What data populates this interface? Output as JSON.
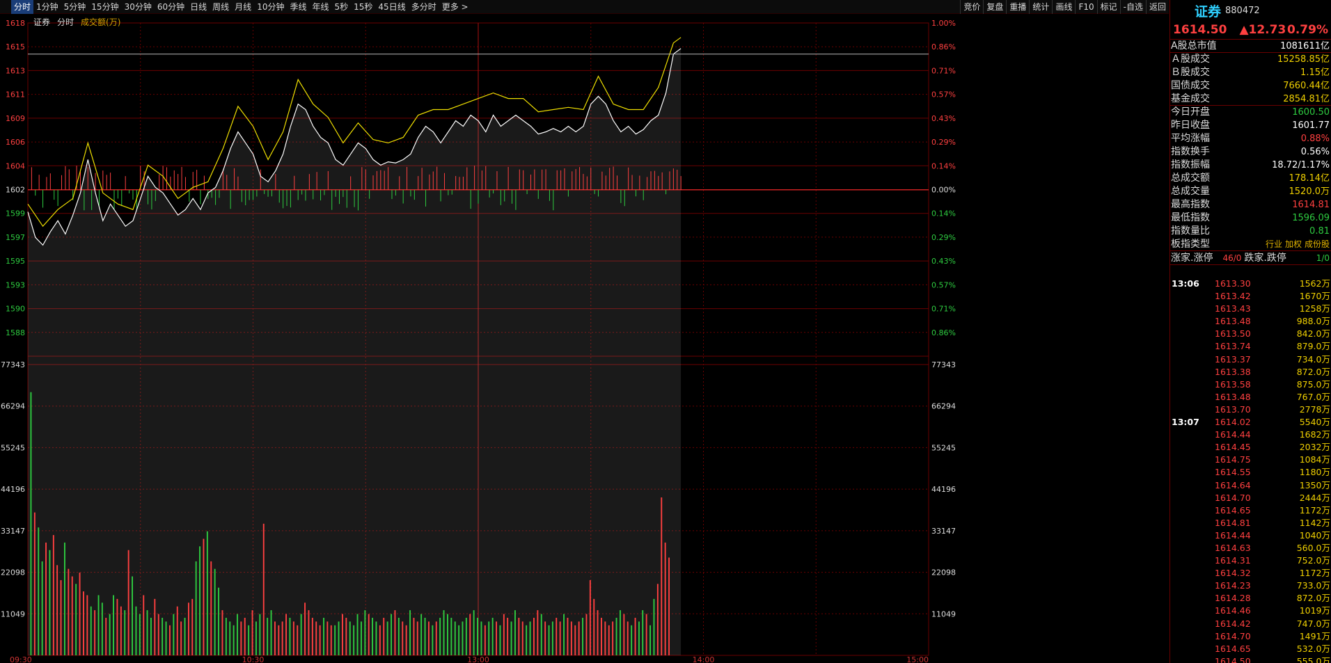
{
  "toolbar": {
    "tabs": [
      "分时",
      "1分钟",
      "5分钟",
      "15分钟",
      "30分钟",
      "60分钟",
      "日线",
      "周线",
      "月线",
      "10分钟",
      "季线",
      "年线",
      "5秒",
      "15秒",
      "45日线",
      "多分时",
      "更多 >"
    ],
    "active_tab": 0,
    "buttons": [
      "竞价",
      "复盘",
      "重播",
      "统计",
      "画线",
      "F10",
      "标记",
      "-自选",
      "返回"
    ]
  },
  "legend": {
    "name": "证券",
    "mode": "分时",
    "vol_label": "成交额(万)"
  },
  "colors": {
    "up": "#ff4040",
    "down": "#2ecc40",
    "price": "#ffffff",
    "avg": "#f0e000",
    "grid": "#6b0000"
  },
  "chart_data": {
    "type": "line",
    "prev_close": 1601.77,
    "price_ylim": [
      1586.8,
      1616.8
    ],
    "price_ticks": [
      {
        "v": "1618",
        "pct": "1.00%",
        "dir": "up"
      },
      {
        "v": "1615",
        "pct": "0.86%",
        "dir": "up"
      },
      {
        "v": "1613",
        "pct": "0.71%",
        "dir": "up"
      },
      {
        "v": "1611",
        "pct": "0.57%",
        "dir": "up"
      },
      {
        "v": "1609",
        "pct": "0.43%",
        "dir": "up"
      },
      {
        "v": "1606",
        "pct": "0.29%",
        "dir": "up"
      },
      {
        "v": "1604",
        "pct": "0.14%",
        "dir": "up"
      },
      {
        "v": "1602",
        "pct": "0.00%",
        "dir": "flat"
      },
      {
        "v": "1599",
        "pct": "0.14%",
        "dir": "down"
      },
      {
        "v": "1597",
        "pct": "0.29%",
        "dir": "down"
      },
      {
        "v": "1595",
        "pct": "0.43%",
        "dir": "down"
      },
      {
        "v": "1593",
        "pct": "0.57%",
        "dir": "down"
      },
      {
        "v": "1590",
        "pct": "0.71%",
        "dir": "down"
      },
      {
        "v": "1588",
        "pct": "0.86%",
        "dir": "down"
      }
    ],
    "vol_ticks": [
      "77343",
      "66294",
      "55245",
      "44196",
      "33147",
      "22098",
      "11049"
    ],
    "vol_max": 77343,
    "time_ticks": [
      "09:30",
      "10:30",
      "13:00",
      "14:00",
      "15:00"
    ],
    "total_minutes": 240,
    "price_series": [
      {
        "t": 0,
        "v": 1599.8
      },
      {
        "t": 2,
        "v": 1597.5
      },
      {
        "t": 4,
        "v": 1596.8
      },
      {
        "t": 6,
        "v": 1598.0
      },
      {
        "t": 8,
        "v": 1599.0
      },
      {
        "t": 10,
        "v": 1597.8
      },
      {
        "t": 12,
        "v": 1599.5
      },
      {
        "t": 14,
        "v": 1601.5
      },
      {
        "t": 16,
        "v": 1604.5
      },
      {
        "t": 18,
        "v": 1601.5
      },
      {
        "t": 20,
        "v": 1599.0
      },
      {
        "t": 22,
        "v": 1600.5
      },
      {
        "t": 24,
        "v": 1599.5
      },
      {
        "t": 26,
        "v": 1598.5
      },
      {
        "t": 28,
        "v": 1599.0
      },
      {
        "t": 30,
        "v": 1601.0
      },
      {
        "t": 32,
        "v": 1603.0
      },
      {
        "t": 34,
        "v": 1602.0
      },
      {
        "t": 36,
        "v": 1601.5
      },
      {
        "t": 38,
        "v": 1600.5
      },
      {
        "t": 40,
        "v": 1599.5
      },
      {
        "t": 42,
        "v": 1600.0
      },
      {
        "t": 44,
        "v": 1601.0
      },
      {
        "t": 46,
        "v": 1600.0
      },
      {
        "t": 48,
        "v": 1601.5
      },
      {
        "t": 50,
        "v": 1602.0
      },
      {
        "t": 52,
        "v": 1603.5
      },
      {
        "t": 54,
        "v": 1605.5
      },
      {
        "t": 56,
        "v": 1607.0
      },
      {
        "t": 58,
        "v": 1606.0
      },
      {
        "t": 60,
        "v": 1605.0
      },
      {
        "t": 62,
        "v": 1603.0
      },
      {
        "t": 64,
        "v": 1602.5
      },
      {
        "t": 66,
        "v": 1603.5
      },
      {
        "t": 68,
        "v": 1605.0
      },
      {
        "t": 70,
        "v": 1607.5
      },
      {
        "t": 72,
        "v": 1609.5
      },
      {
        "t": 74,
        "v": 1609.0
      },
      {
        "t": 76,
        "v": 1607.5
      },
      {
        "t": 78,
        "v": 1606.5
      },
      {
        "t": 80,
        "v": 1606.0
      },
      {
        "t": 82,
        "v": 1604.5
      },
      {
        "t": 84,
        "v": 1604.0
      },
      {
        "t": 86,
        "v": 1605.0
      },
      {
        "t": 88,
        "v": 1606.0
      },
      {
        "t": 90,
        "v": 1605.5
      },
      {
        "t": 92,
        "v": 1604.5
      },
      {
        "t": 94,
        "v": 1604.0
      },
      {
        "t": 96,
        "v": 1604.3
      },
      {
        "t": 98,
        "v": 1604.2
      },
      {
        "t": 100,
        "v": 1604.5
      },
      {
        "t": 102,
        "v": 1605.0
      },
      {
        "t": 104,
        "v": 1606.5
      },
      {
        "t": 106,
        "v": 1607.5
      },
      {
        "t": 108,
        "v": 1607.0
      },
      {
        "t": 110,
        "v": 1606.0
      },
      {
        "t": 112,
        "v": 1607.0
      },
      {
        "t": 114,
        "v": 1608.0
      },
      {
        "t": 116,
        "v": 1607.5
      },
      {
        "t": 118,
        "v": 1608.5
      },
      {
        "t": 120,
        "v": 1608.0
      },
      {
        "t": 122,
        "v": 1607.0
      },
      {
        "t": 124,
        "v": 1608.5
      },
      {
        "t": 126,
        "v": 1607.5
      },
      {
        "t": 128,
        "v": 1608.0
      },
      {
        "t": 130,
        "v": 1608.5
      },
      {
        "t": 132,
        "v": 1608.0
      },
      {
        "t": 134,
        "v": 1607.5
      },
      {
        "t": 136,
        "v": 1606.8
      },
      {
        "t": 138,
        "v": 1607.0
      },
      {
        "t": 140,
        "v": 1607.3
      },
      {
        "t": 142,
        "v": 1607.0
      },
      {
        "t": 144,
        "v": 1607.5
      },
      {
        "t": 146,
        "v": 1607.0
      },
      {
        "t": 148,
        "v": 1607.5
      },
      {
        "t": 150,
        "v": 1609.5
      },
      {
        "t": 152,
        "v": 1610.2
      },
      {
        "t": 154,
        "v": 1609.5
      },
      {
        "t": 156,
        "v": 1608.0
      },
      {
        "t": 158,
        "v": 1607.0
      },
      {
        "t": 160,
        "v": 1607.5
      },
      {
        "t": 162,
        "v": 1606.8
      },
      {
        "t": 164,
        "v": 1607.2
      },
      {
        "t": 166,
        "v": 1608.0
      },
      {
        "t": 168,
        "v": 1608.5
      },
      {
        "t": 170,
        "v": 1610.5
      },
      {
        "t": 172,
        "v": 1614.0
      },
      {
        "t": 174,
        "v": 1614.5
      }
    ],
    "avg_series": [
      {
        "t": 0,
        "v": 1600.5
      },
      {
        "t": 4,
        "v": 1598.5
      },
      {
        "t": 8,
        "v": 1600.0
      },
      {
        "t": 12,
        "v": 1601.0
      },
      {
        "t": 16,
        "v": 1606.0
      },
      {
        "t": 20,
        "v": 1601.5
      },
      {
        "t": 24,
        "v": 1600.5
      },
      {
        "t": 28,
        "v": 1600.0
      },
      {
        "t": 32,
        "v": 1604.0
      },
      {
        "t": 36,
        "v": 1603.0
      },
      {
        "t": 40,
        "v": 1601.0
      },
      {
        "t": 44,
        "v": 1602.0
      },
      {
        "t": 48,
        "v": 1602.5
      },
      {
        "t": 52,
        "v": 1605.5
      },
      {
        "t": 56,
        "v": 1609.3
      },
      {
        "t": 60,
        "v": 1607.5
      },
      {
        "t": 64,
        "v": 1604.5
      },
      {
        "t": 68,
        "v": 1607.0
      },
      {
        "t": 72,
        "v": 1611.7
      },
      {
        "t": 76,
        "v": 1609.5
      },
      {
        "t": 80,
        "v": 1608.3
      },
      {
        "t": 84,
        "v": 1606.0
      },
      {
        "t": 88,
        "v": 1607.8
      },
      {
        "t": 92,
        "v": 1606.3
      },
      {
        "t": 96,
        "v": 1606.0
      },
      {
        "t": 100,
        "v": 1606.5
      },
      {
        "t": 104,
        "v": 1608.5
      },
      {
        "t": 108,
        "v": 1609.0
      },
      {
        "t": 112,
        "v": 1609.0
      },
      {
        "t": 116,
        "v": 1609.5
      },
      {
        "t": 120,
        "v": 1610.0
      },
      {
        "t": 124,
        "v": 1610.5
      },
      {
        "t": 128,
        "v": 1610.0
      },
      {
        "t": 132,
        "v": 1610.0
      },
      {
        "t": 136,
        "v": 1608.8
      },
      {
        "t": 140,
        "v": 1609.0
      },
      {
        "t": 144,
        "v": 1609.2
      },
      {
        "t": 148,
        "v": 1609.0
      },
      {
        "t": 152,
        "v": 1612.0
      },
      {
        "t": 156,
        "v": 1609.5
      },
      {
        "t": 160,
        "v": 1609.0
      },
      {
        "t": 164,
        "v": 1609.0
      },
      {
        "t": 168,
        "v": 1611.0
      },
      {
        "t": 172,
        "v": 1615.0
      },
      {
        "t": 174,
        "v": 1615.5
      }
    ],
    "volume_sizes": [
      70000,
      38000,
      34000,
      25000,
      30000,
      28000,
      32000,
      24000,
      20000,
      30000,
      23000,
      21000,
      19000,
      22000,
      17000,
      16000,
      13000,
      12000,
      16000,
      14000,
      10000,
      11000,
      16000,
      15000,
      13000,
      12000,
      28000,
      21000,
      13000,
      11000,
      16000,
      12000,
      10000,
      15000,
      11000,
      10000,
      9000,
      8000,
      11000,
      13000,
      9000,
      10000,
      14000,
      15000,
      25000,
      29000,
      31000,
      33000,
      25000,
      23000,
      18000,
      12000,
      10000,
      9000,
      8000,
      11000,
      9000,
      10000,
      8000,
      12000,
      9000,
      11000,
      35000,
      10000,
      12000,
      9000,
      8000,
      9000,
      11000,
      10000,
      9000,
      8000,
      11000,
      14000,
      12000,
      10000,
      9000,
      8000,
      10000,
      9000,
      8000,
      8000,
      9000,
      11000,
      10000,
      9000,
      8000,
      11000,
      9000,
      12000,
      11000,
      10000,
      9000,
      8000,
      10000,
      9000,
      11000,
      12000,
      10000,
      9000,
      8000,
      12000,
      10000,
      9000,
      11000,
      10000,
      9000,
      8000,
      9000,
      10000,
      12000,
      11000,
      10000,
      9000,
      8000,
      9000,
      10000,
      11000,
      12000,
      10000,
      9000,
      8000,
      9000,
      10000,
      9000,
      8000,
      11000,
      10000,
      9000,
      12000,
      10000,
      9000,
      8000,
      9000,
      10000,
      12000,
      11000,
      9000,
      8000,
      9000,
      10000,
      9000,
      11000,
      10000,
      9000,
      8000,
      9000,
      10000,
      11000,
      20000,
      15000,
      12000,
      10000,
      9000,
      8000,
      9000,
      10000,
      12000,
      11000,
      9000,
      8000,
      10000,
      9000,
      12000,
      11000,
      8000,
      15000,
      19000,
      42000,
      30000,
      26000
    ]
  },
  "panel": {
    "name": "证券",
    "code": "880472",
    "price": "1614.50",
    "change": "▲12.73",
    "pct": "0.79%",
    "stats": [
      {
        "label": "A股总市值",
        "value": "1081611亿",
        "color": "#ffffff"
      },
      {
        "label": "Ａ股成交",
        "value": "15258.85亿",
        "color": "#f0d000"
      },
      {
        "label": "Ｂ股成交",
        "value": "1.15亿",
        "color": "#f0d000"
      },
      {
        "label": "国债成交",
        "value": "7660.44亿",
        "color": "#f0d000"
      },
      {
        "label": "基金成交",
        "value": "2854.81亿",
        "color": "#f0d000"
      },
      {
        "label": "今日开盘",
        "value": "1600.50",
        "color": "#2ecc40"
      },
      {
        "label": "昨日收盘",
        "value": "1601.77",
        "color": "#ffffff"
      },
      {
        "label": "平均涨幅",
        "value": "0.88%",
        "color": "#ff4040"
      },
      {
        "label": "指数换手",
        "value": "0.56%",
        "color": "#ffffff"
      },
      {
        "label": "指数振幅",
        "value": "18.72/1.17%",
        "color": "#ffffff"
      },
      {
        "label": "总成交额",
        "value": "178.14亿",
        "color": "#f0d000"
      },
      {
        "label": "总成交量",
        "value": "1520.0万",
        "color": "#f0d000"
      },
      {
        "label": "最高指数",
        "value": "1614.81",
        "color": "#ff4040"
      },
      {
        "label": "最低指数",
        "value": "1596.09",
        "color": "#2ecc40"
      },
      {
        "label": "指数量比",
        "value": "0.81",
        "color": "#2ecc40"
      }
    ],
    "board": {
      "label": "板指类型",
      "tags": [
        "行业",
        "加权",
        "成份股"
      ]
    },
    "ups": {
      "label1": "涨家.涨停",
      "val1": "46/0",
      "label2": "跌家.跌停",
      "val2": "1/0"
    },
    "ticks": [
      {
        "t": "13:06",
        "p": "1613.30",
        "v": "1562万"
      },
      {
        "t": "",
        "p": "1613.42",
        "v": "1670万"
      },
      {
        "t": "",
        "p": "1613.43",
        "v": "1258万"
      },
      {
        "t": "",
        "p": "1613.48",
        "v": "988.0万"
      },
      {
        "t": "",
        "p": "1613.50",
        "v": "842.0万"
      },
      {
        "t": "",
        "p": "1613.74",
        "v": "879.0万"
      },
      {
        "t": "",
        "p": "1613.37",
        "v": "734.0万"
      },
      {
        "t": "",
        "p": "1613.38",
        "v": "872.0万"
      },
      {
        "t": "",
        "p": "1613.58",
        "v": "875.0万"
      },
      {
        "t": "",
        "p": "1613.48",
        "v": "767.0万"
      },
      {
        "t": "",
        "p": "1613.70",
        "v": "2778万"
      },
      {
        "t": "13:07",
        "p": "1614.02",
        "v": "5540万"
      },
      {
        "t": "",
        "p": "1614.44",
        "v": "1682万"
      },
      {
        "t": "",
        "p": "1614.45",
        "v": "2032万"
      },
      {
        "t": "",
        "p": "1614.75",
        "v": "1084万"
      },
      {
        "t": "",
        "p": "1614.55",
        "v": "1180万"
      },
      {
        "t": "",
        "p": "1614.64",
        "v": "1350万"
      },
      {
        "t": "",
        "p": "1614.70",
        "v": "2444万"
      },
      {
        "t": "",
        "p": "1614.65",
        "v": "1172万"
      },
      {
        "t": "",
        "p": "1614.81",
        "v": "1142万"
      },
      {
        "t": "",
        "p": "1614.44",
        "v": "1040万"
      },
      {
        "t": "",
        "p": "1614.63",
        "v": "560.0万"
      },
      {
        "t": "",
        "p": "1614.31",
        "v": "752.0万"
      },
      {
        "t": "",
        "p": "1614.32",
        "v": "1172万"
      },
      {
        "t": "",
        "p": "1614.23",
        "v": "733.0万"
      },
      {
        "t": "",
        "p": "1614.28",
        "v": "872.0万"
      },
      {
        "t": "",
        "p": "1614.46",
        "v": "1019万"
      },
      {
        "t": "",
        "p": "1614.42",
        "v": "747.0万"
      },
      {
        "t": "",
        "p": "1614.70",
        "v": "1491万"
      },
      {
        "t": "",
        "p": "1614.65",
        "v": "532.0万"
      },
      {
        "t": "",
        "p": "1614.50",
        "v": "555.0万"
      }
    ]
  }
}
